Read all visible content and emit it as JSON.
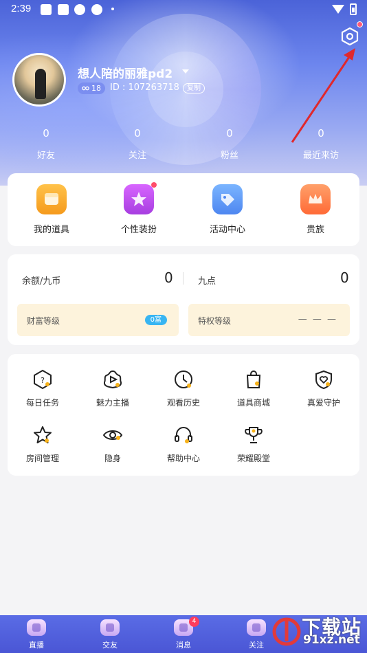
{
  "status_bar": {
    "time": "2:39"
  },
  "profile": {
    "username": "想人陪的丽雅pd2",
    "level": "18",
    "id_text": "ID : 107263718",
    "copy_label": "复制"
  },
  "stats": [
    {
      "value": "0",
      "label": "好友"
    },
    {
      "value": "0",
      "label": "关注"
    },
    {
      "value": "0",
      "label": "粉丝"
    },
    {
      "value": "0",
      "label": "最近来访"
    }
  ],
  "features": [
    {
      "label": "我的道具",
      "icon": "props-box-icon",
      "color": "#f7a92c"
    },
    {
      "label": "个性装扮",
      "icon": "magic-wand-icon",
      "color": "#c04ee8"
    },
    {
      "label": "活动中心",
      "icon": "tag-icon",
      "color": "#4d8df2"
    },
    {
      "label": "贵族",
      "icon": "crown-icon",
      "color": "#ff7a3e"
    }
  ],
  "balance": {
    "coin_label": "余额/九币",
    "coin_value": "0",
    "points_label": "九点",
    "points_value": "0",
    "wealth_label": "财富等级",
    "wealth_tag": "0富",
    "privilege_label": "特权等级",
    "privilege_value": "— — —"
  },
  "menu": [
    {
      "label": "每日任务",
      "icon": "daily-task-icon"
    },
    {
      "label": "魅力主播",
      "icon": "charm-anchor-icon"
    },
    {
      "label": "观看历史",
      "icon": "history-clock-icon"
    },
    {
      "label": "道具商城",
      "icon": "shop-bag-icon"
    },
    {
      "label": "真爱守护",
      "icon": "heart-shield-icon"
    },
    {
      "label": "房间管理",
      "icon": "star-icon"
    },
    {
      "label": "隐身",
      "icon": "eye-icon"
    },
    {
      "label": "帮助中心",
      "icon": "headset-icon"
    },
    {
      "label": "荣耀殿堂",
      "icon": "trophy-icon"
    }
  ],
  "tabs": [
    {
      "label": "直播"
    },
    {
      "label": "交友"
    },
    {
      "label": "消息",
      "badge": "4"
    },
    {
      "label": "关注"
    }
  ],
  "watermark": {
    "title": "下载站",
    "url": "91xz.net"
  },
  "colors": {
    "accent_blue": "#4a56d5",
    "annotation_red": "#e0282c",
    "badge_red": "#ff4d6a"
  }
}
